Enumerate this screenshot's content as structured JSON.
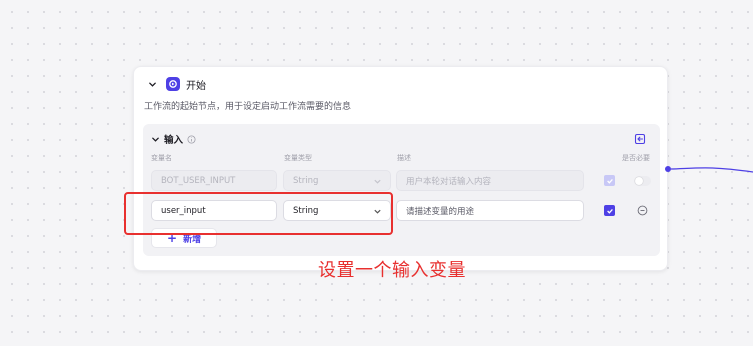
{
  "node": {
    "title": "开始",
    "description": "工作流的起始节点，用于设定启动工作流需要的信息",
    "icon": "start-node-icon"
  },
  "input_section": {
    "title": "输入",
    "columns": {
      "name": "变量名",
      "type": "变量类型",
      "description": "描述",
      "required": "是否必要"
    },
    "rows": [
      {
        "name": "BOT_USER_INPUT",
        "type": "String",
        "description": "用户本轮对话输入内容",
        "required": true,
        "editable": false
      },
      {
        "name": "user_input",
        "type": "String",
        "description_placeholder": "请描述变量的用途",
        "required": true,
        "editable": true
      }
    ],
    "add_label": "新增"
  },
  "annotation": "设置一个输入变量",
  "colors": {
    "accent": "#4e40e5",
    "highlight": "#e8302f"
  }
}
